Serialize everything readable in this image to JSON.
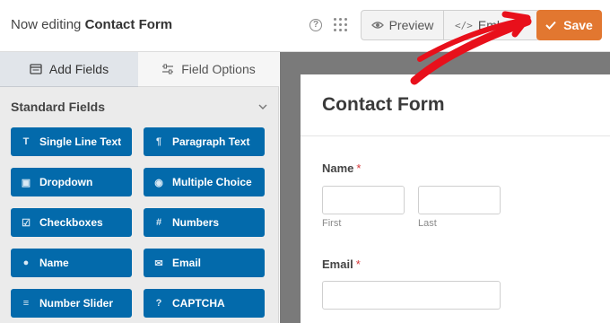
{
  "header": {
    "title_prefix": "Now editing",
    "form_name": "Contact Form",
    "help_label": "?",
    "preview_label": "Preview",
    "embed_label": "Embed",
    "save_label": "Save",
    "save_color": "#e27730"
  },
  "left_panel": {
    "tabs": [
      {
        "label": "Add Fields",
        "icon": "add-fields-icon",
        "active": true
      },
      {
        "label": "Field Options",
        "icon": "sliders-icon",
        "active": false
      }
    ],
    "section_title": "Standard Fields",
    "fields": [
      {
        "label": "Single Line Text",
        "icon": "text-cursor-icon",
        "glyph": "T̲"
      },
      {
        "label": "Paragraph Text",
        "icon": "paragraph-icon",
        "glyph": "¶"
      },
      {
        "label": "Dropdown",
        "icon": "dropdown-icon",
        "glyph": "▣"
      },
      {
        "label": "Multiple Choice",
        "icon": "radio-icon",
        "glyph": "◉"
      },
      {
        "label": "Checkboxes",
        "icon": "checkbox-icon",
        "glyph": "☑"
      },
      {
        "label": "Numbers",
        "icon": "hash-icon",
        "glyph": "#"
      },
      {
        "label": "Name",
        "icon": "user-icon",
        "glyph": "●"
      },
      {
        "label": "Email",
        "icon": "envelope-icon",
        "glyph": "✉"
      },
      {
        "label": "Number Slider",
        "icon": "slider-icon",
        "glyph": "≡"
      },
      {
        "label": "CAPTCHA",
        "icon": "question-circle-icon",
        "glyph": "?"
      }
    ],
    "button_color": "#036aab"
  },
  "form_preview": {
    "title": "Contact Form",
    "name_label": "Name",
    "required_marker": "*",
    "first_sublabel": "First",
    "last_sublabel": "Last",
    "email_label": "Email"
  }
}
